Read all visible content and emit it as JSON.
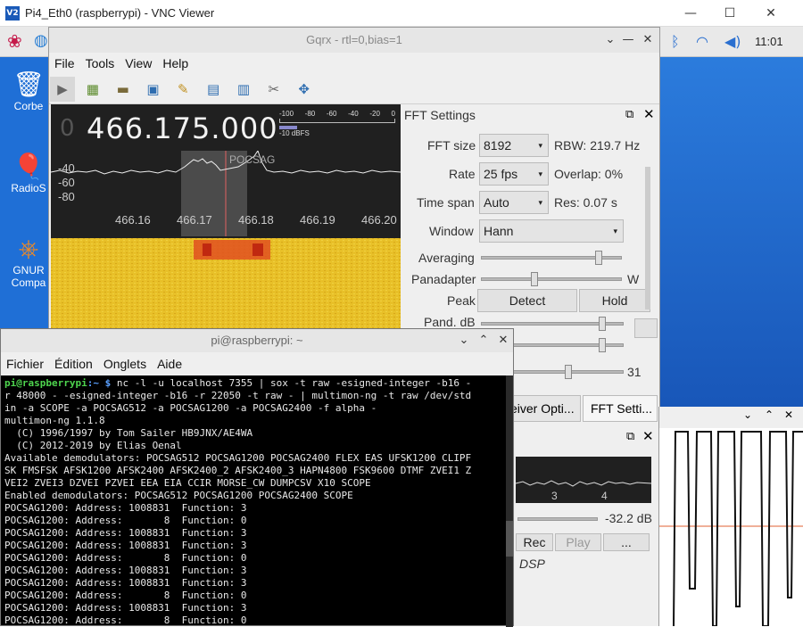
{
  "vnc": {
    "title": "Pi4_Eth0 (raspberrypi) - VNC Viewer",
    "logo": "V2",
    "minimize": "—",
    "maximize": "☐",
    "close": "✕"
  },
  "panel": {
    "clock": "11:01",
    "icons": [
      "raspberry-icon",
      "globe-icon",
      "bluetooth-icon",
      "wifi-icon",
      "volume-icon"
    ]
  },
  "desktop": {
    "icons": [
      {
        "label": "Corbe",
        "icon": "trash-icon"
      },
      {
        "label": "RadioS",
        "icon": "balloon-icon"
      },
      {
        "label": "GNUR",
        "label2": "Compa",
        "icon": "gnuradio-icon"
      }
    ]
  },
  "gqrx": {
    "title": "Gqrx  - rtl=0,bias=1",
    "menu": [
      "File",
      "Tools",
      "View",
      "Help"
    ],
    "frequency": "466.175.000",
    "frequency_leading": "0",
    "db_ticks": [
      "-100",
      "-80",
      "-60",
      "-40",
      "-20",
      "0"
    ],
    "db_label": "-10 dBFS",
    "y_ticks": [
      "-40",
      "-60",
      "-80"
    ],
    "x_ticks": [
      "466.16",
      "466.17",
      "466.18",
      "466.19",
      "466.20"
    ],
    "signal_label": "POCSAG",
    "tabs": [
      "eiver Opti...",
      "FFT Setti..."
    ],
    "audio": {
      "level": "-32.2 dB",
      "rec": "Rec",
      "play": "Play",
      "more": "...",
      "dsp": "DSP",
      "x_ticks": [
        "3",
        "4"
      ]
    }
  },
  "fft_settings": {
    "title": "FFT Settings",
    "fft_size_label": "FFT size",
    "fft_size": "8192",
    "rbw": "RBW: 219.7 Hz",
    "rate_label": "Rate",
    "rate": "25 fps",
    "overlap": "Overlap: 0%",
    "timespan_label": "Time span",
    "timespan": "Auto",
    "res": "Res: 0.07 s",
    "window_label": "Window",
    "window": "Hann",
    "averaging_label": "Averaging",
    "averaging": 0.85,
    "panadapter_label": "Panadapter",
    "panadapter": 0.37,
    "panadapter_tail": "W",
    "peak_label": "Peak",
    "detect": "Detect",
    "hold": "Hold",
    "pand_db_label": "Pand. dB",
    "side_value": "31"
  },
  "terminal": {
    "title": "pi@raspberrypi: ~",
    "menu": [
      "Fichier",
      "Édition",
      "Onglets",
      "Aide"
    ],
    "prompt_user": "pi@raspberrypi",
    "prompt_path": ":~ $ ",
    "command": "nc -l -u localhost 7355 | sox -t raw -esigned-integer -b16 -",
    "lines": [
      "r 48000 - -esigned-integer -b16 -r 22050 -t raw - | multimon-ng -t raw /dev/std",
      "in -a SCOPE -a POCSAG512 -a POCSAG1200 -a POCSAG2400 -f alpha -",
      "multimon-ng 1.1.8",
      "  (C) 1996/1997 by Tom Sailer HB9JNX/AE4WA",
      "  (C) 2012-2019 by Elias Oenal",
      "Available demodulators: POCSAG512 POCSAG1200 POCSAG2400 FLEX EAS UFSK1200 CLIPF",
      "SK FMSFSK AFSK1200 AFSK2400 AFSK2400_2 AFSK2400_3 HAPN4800 FSK9600 DTMF ZVEI1 Z",
      "VEI2 ZVEI3 DZVEI PZVEI EEA EIA CCIR MORSE_CW DUMPCSV X10 SCOPE",
      "Enabled demodulators: POCSAG512 POCSAG1200 POCSAG2400 SCOPE",
      "POCSAG1200: Address: 1008831  Function: 3",
      "POCSAG1200: Address:       8  Function: 0",
      "POCSAG1200: Address: 1008831  Function: 3",
      "POCSAG1200: Address: 1008831  Function: 3",
      "POCSAG1200: Address:       8  Function: 0",
      "POCSAG1200: Address: 1008831  Function: 3",
      "POCSAG1200: Address: 1008831  Function: 3",
      "POCSAG1200: Address:       8  Function: 0",
      "POCSAG1200: Address: 1008831  Function: 3",
      "POCSAG1200: Address:       8  Function: 0"
    ]
  },
  "colors": {
    "accent": "#1a5ab8",
    "prompt_user": "#4ed44e",
    "prompt_path": "#5aa0ff",
    "waterfall": "#e8c028",
    "center_line": "#e06060"
  }
}
